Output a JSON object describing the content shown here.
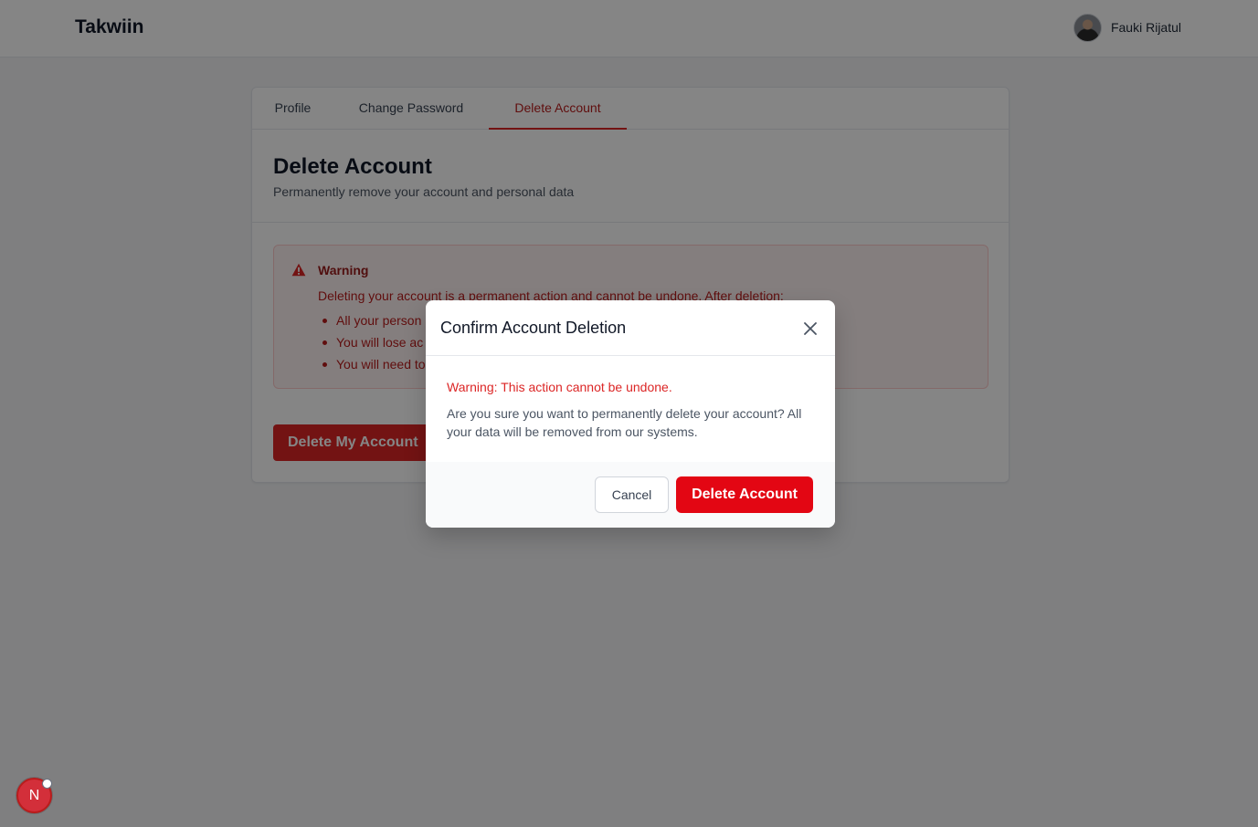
{
  "app": {
    "brand": "Takwiin"
  },
  "user": {
    "name": "Fauki Rijatul"
  },
  "tabs": [
    {
      "label": "Profile",
      "active": false
    },
    {
      "label": "Change Password",
      "active": false
    },
    {
      "label": "Delete Account",
      "active": true
    }
  ],
  "page": {
    "title": "Delete Account",
    "subtitle": "Permanently remove your account and personal data"
  },
  "warning_box": {
    "title": "Warning",
    "body": "Deleting your account is a permanent action and cannot be undone. After deletion:",
    "items": [
      "All your person",
      "You will lose ac",
      "You will need to"
    ]
  },
  "actions": {
    "delete_my_account": "Delete My Account"
  },
  "modal": {
    "title": "Confirm Account Deletion",
    "warning": "Warning: This action cannot be undone.",
    "message": "Are you sure you want to permanently delete your account? All your data will be removed from our systems.",
    "cancel_label": "Cancel",
    "confirm_label": "Delete Account"
  },
  "badge": {
    "label": "N"
  },
  "icons": {
    "warning": "warning-triangle-icon",
    "close": "close-icon",
    "avatar": "avatar"
  },
  "colors": {
    "accent_red": "#dc2626",
    "confirm_red": "#e30613",
    "warning_bg": "#fef2f2",
    "overlay": "rgba(0,0,0,0.48)"
  }
}
